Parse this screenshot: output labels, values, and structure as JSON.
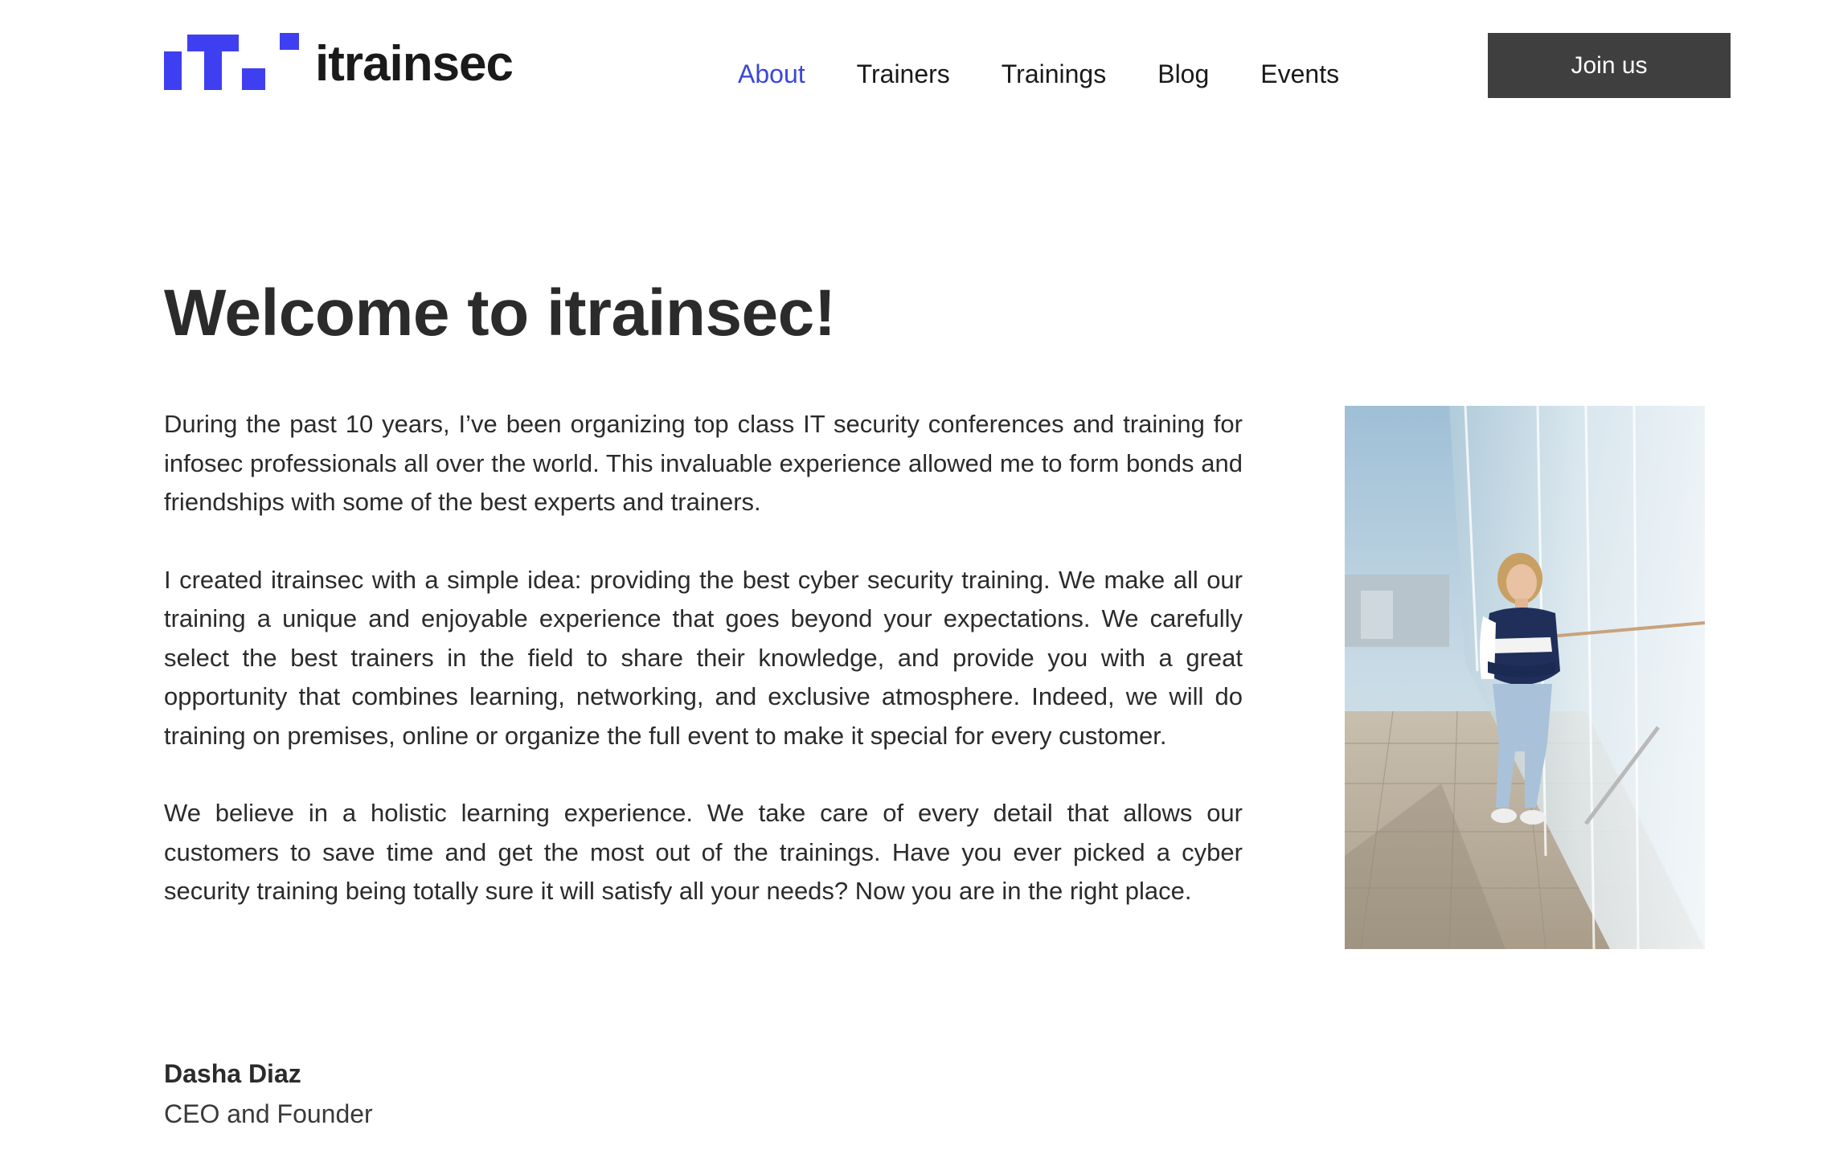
{
  "header": {
    "logo_text": "itrainsec",
    "brand_color": "#3f3ff2",
    "nav": [
      {
        "label": "About",
        "active": true
      },
      {
        "label": "Trainers",
        "active": false
      },
      {
        "label": "Trainings",
        "active": false
      },
      {
        "label": "Blog",
        "active": false
      },
      {
        "label": "Events",
        "active": false
      }
    ],
    "cta_label": "Join us"
  },
  "main": {
    "title": "Welcome to itrainsec!",
    "paragraphs": [
      "During the past 10 years, I’ve been organizing top class IT security conferences and training for infosec professionals all over the world. This invaluable experience allowed me to form bonds and friendships with some of the best experts and trainers.",
      "I created itrainsec with a simple idea: providing the best cyber security training. We make all our training a unique and enjoyable experience that goes beyond your expectations. We carefully select the best trainers in the field to share their knowledge, and provide you with a great opportunity that combines learning, networking, and exclusive atmosphere. Indeed, we will do training on premises, online or organize the full event to make it special for every customer.",
      "We believe in a holistic learning experience. We take care of every detail that allows our customers to save time and get the most out of the trainings. Have you ever picked a cyber security training being totally sure it will satisfy all your needs? Now you are in the right place."
    ],
    "signature": {
      "name": "Dasha Diaz",
      "role": "CEO and Founder"
    }
  },
  "colors": {
    "nav_active": "#3b47d9",
    "cta_background": "#3f3f3f",
    "text": "#2b2b2b"
  }
}
